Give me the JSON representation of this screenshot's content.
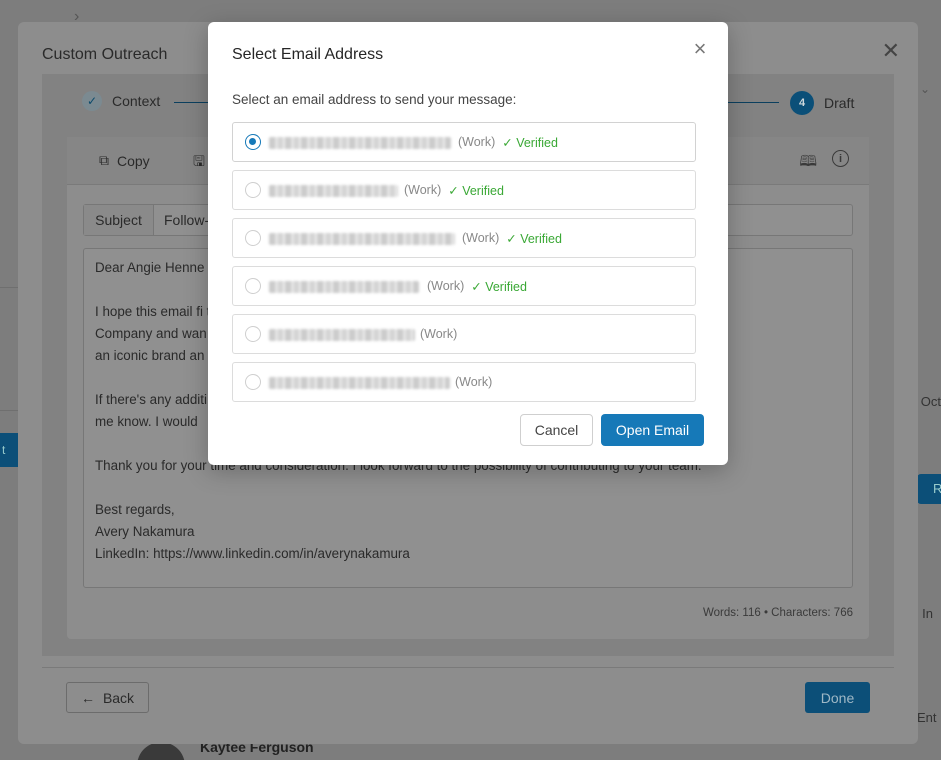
{
  "background": {
    "partial_oct": "Oct",
    "partial_in": "In",
    "partial_ent": "Ent",
    "partial_left_btn": "t",
    "partial_right_btn": "R",
    "contact_name": "Kaytee Ferguson"
  },
  "outreach": {
    "title": "Custom Outreach",
    "steps": [
      {
        "label": "Context",
        "state": "done"
      },
      {
        "label": "Draft",
        "number": "4",
        "state": "active"
      }
    ],
    "toolbar": {
      "copy_label": "Copy"
    },
    "subject_label": "Subject",
    "subject_value": "Follow-",
    "body": {
      "greeting": "Dear Angie Henne",
      "p1": "I hope this email fi                                                                                  t The Walt Disney\nCompany and wan                                                                                  contribute to such\nan iconic brand an",
      "p2": "If there's any additi                                                                                  t hesitate to let\nme know. I would",
      "p3": "Thank you for your time and consideration. I look forward to the possibility of contributing to your team.",
      "closing": "Best regards,\nAvery Nakamura\nLinkedIn: https://www.linkedin.com/in/averynakamura"
    },
    "counts": "Words: 116 • Characters: 766",
    "back_label": "Back",
    "done_label": "Done"
  },
  "modal": {
    "title": "Select Email Address",
    "instruction": "Select an email address to send your message:",
    "options": [
      {
        "type": "(Work)",
        "verified": "✓ Verified",
        "selected": true
      },
      {
        "type": "(Work)",
        "verified": "✓ Verified",
        "selected": false
      },
      {
        "type": "(Work)",
        "verified": "✓ Verified",
        "selected": false
      },
      {
        "type": "(Work)",
        "verified": "✓ Verified",
        "selected": false
      },
      {
        "type": "(Work)",
        "verified": "",
        "selected": false
      },
      {
        "type": "(Work)",
        "verified": "",
        "selected": false
      }
    ],
    "cancel_label": "Cancel",
    "open_label": "Open Email"
  },
  "colors": {
    "primary": "#1679b8",
    "verified": "#3aa835",
    "overlay_primary": "#0c4f78"
  }
}
